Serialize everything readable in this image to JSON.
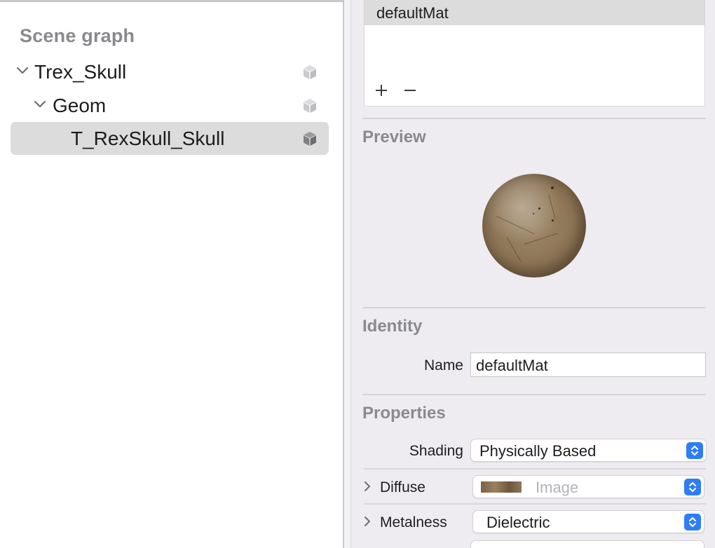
{
  "scene_graph": {
    "title": "Scene graph",
    "nodes": [
      {
        "label": "Trex_Skull",
        "expanded": true,
        "icon": "cube-icon"
      },
      {
        "label": "Geom",
        "expanded": true,
        "icon": "cube-icon"
      },
      {
        "label": "T_RexSkull_Skull",
        "selected": true,
        "icon": "cube-icon"
      }
    ]
  },
  "materials": {
    "items": [
      "defaultMat"
    ],
    "add_icon": "plus-icon",
    "remove_icon": "minus-icon"
  },
  "preview": {
    "title": "Preview"
  },
  "identity": {
    "title": "Identity",
    "name_label": "Name",
    "name_value": "defaultMat"
  },
  "properties": {
    "title": "Properties",
    "shading_label": "Shading",
    "shading_value": "Physically Based",
    "diffuse_label": "Diffuse",
    "diffuse_value": "Image",
    "metalness_label": "Metalness",
    "metalness_value": "Dielectric"
  },
  "colors": {
    "accent": "#2f7df6",
    "selection": "#dcdcdc",
    "inspector_bg": "#eeecf1",
    "section_title": "#8a8a8e"
  }
}
